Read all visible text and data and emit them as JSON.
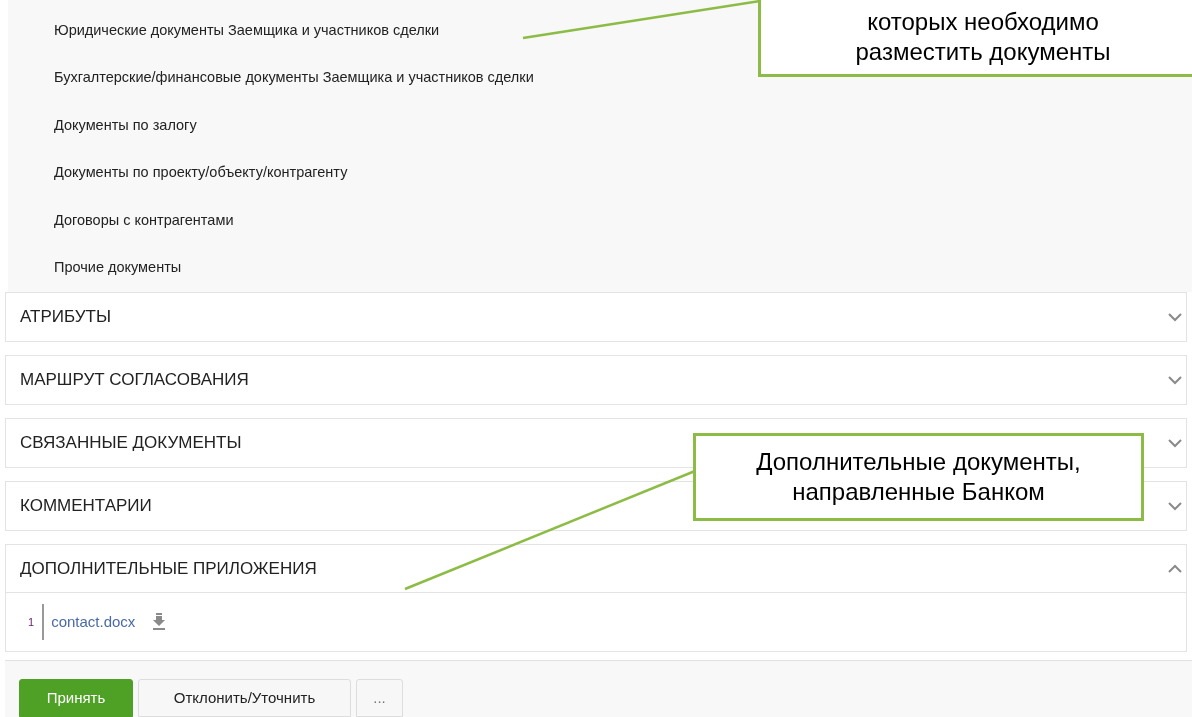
{
  "document_types": [
    "Юридические документы Заемщика и участников сделки",
    "Бухгалтерские/финансовые документы Заемщика и участников сделки",
    "Документы по залогу",
    "Документы по проекту/объекту/контрагенту",
    "Договоры с контрагентами",
    "Прочие документы"
  ],
  "sections": [
    {
      "title": "АТРИБУТЫ",
      "expanded": false
    },
    {
      "title": "МАРШРУТ СОГЛАСОВАНИЯ",
      "expanded": false
    },
    {
      "title": "СВЯЗАННЫЕ ДОКУМЕНТЫ",
      "expanded": false
    },
    {
      "title": "КОММЕНТАРИИ",
      "expanded": false
    },
    {
      "title": "ДОПОЛНИТЕЛЬНЫЕ ПРИЛОЖЕНИЯ",
      "expanded": true,
      "files": [
        {
          "number": "1",
          "name": "contact.docx"
        }
      ]
    }
  ],
  "buttons": [
    {
      "label": "Принять",
      "kind": "primary"
    },
    {
      "label": "Отклонить/Уточнить",
      "kind": "secondary"
    },
    {
      "label": "...",
      "kind": "more"
    }
  ],
  "callouts": [
    {
      "lines": [
        "которых необходимо",
        "разместить документы"
      ]
    },
    {
      "lines": [
        "Дополнительные документы,",
        "направленные Банком"
      ]
    }
  ]
}
